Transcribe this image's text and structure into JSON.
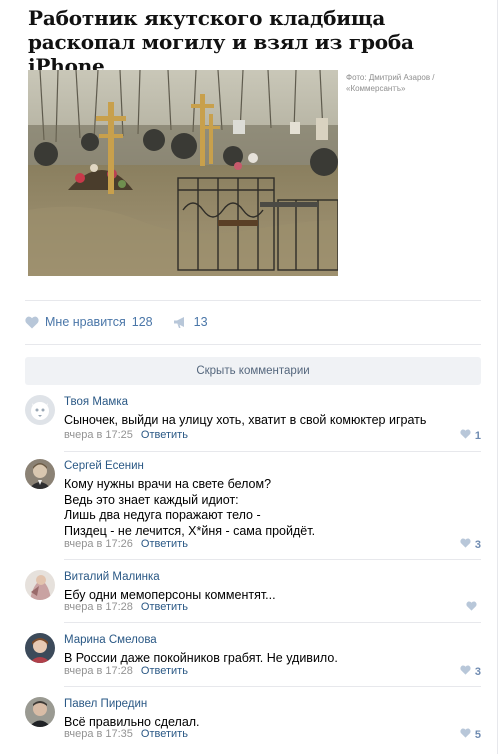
{
  "post": {
    "headline": "Работник якутского кладбища раскопал могилу и взял из гроба iPhone",
    "photo_caption": "Фото: Дмитрий Азаров / «Коммерсантъ»",
    "likes_label": "Мне нравится",
    "likes_count": "128",
    "shares_count": "13",
    "hide_comments_label": "Скрыть комментарии"
  },
  "colors": {
    "link": "#2a5885",
    "accent": "#4a76a8",
    "meta": "#939393"
  },
  "icons": {
    "like": "heart-icon",
    "share": "megaphone-icon"
  },
  "comments": [
    {
      "author": "Твоя Мамка",
      "lines": [
        "Сыночек, выйди на улицу хоть, хватит в свой комюктер играть"
      ],
      "time": "вчера в 17:25",
      "reply": "Ответить",
      "likes": "1"
    },
    {
      "author": "Сергей Есенин",
      "lines": [
        "Кому нужны врачи на свете белом?",
        "Ведь это знает каждый идиот:",
        "Лишь два недуга поражают тело -",
        "Пиздец - не лечится, Х*йня - сама пройдёт."
      ],
      "time": "вчера в 17:26",
      "reply": "Ответить",
      "likes": "3"
    },
    {
      "author": "Виталий Малинка",
      "lines": [
        "Ебу одни мемоперсоны комментят..."
      ],
      "time": "вчера в 17:28",
      "reply": "Ответить",
      "likes": ""
    },
    {
      "author": "Марина Смелова",
      "lines": [
        "В России даже покойников грабят. Не удивило."
      ],
      "time": "вчера в 17:28",
      "reply": "Ответить",
      "likes": "3"
    },
    {
      "author": "Павел Пиредин",
      "lines": [
        "Всё правильно сделал."
      ],
      "time": "вчера в 17:35",
      "reply": "Ответить",
      "likes": "5"
    }
  ]
}
